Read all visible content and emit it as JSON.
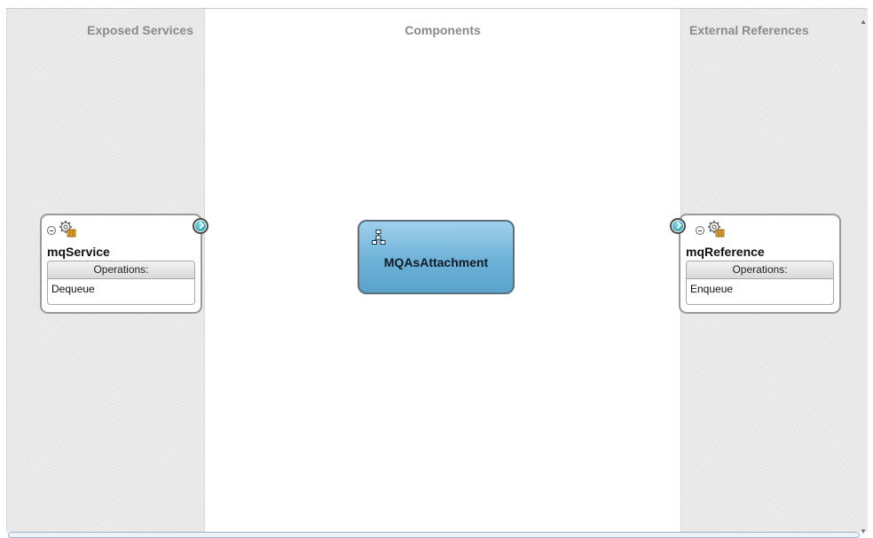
{
  "lanes": {
    "exposed_title": "Exposed Services",
    "components_title": "Components",
    "external_title": "External References"
  },
  "service": {
    "name": "mqService",
    "ops_header": "Operations:",
    "operation": "Dequeue",
    "icon": "adapter-gear-icon"
  },
  "component": {
    "name": "MQAsAttachment",
    "icon": "mediator-icon"
  },
  "reference": {
    "name": "mqReference",
    "ops_header": "Operations:",
    "operation": "Enqueue",
    "icon": "adapter-gear-icon"
  },
  "colors": {
    "component_fill": "#6db1d7",
    "wire_dot": "#1b8fa3",
    "lane_title": "#8a8a8a"
  }
}
